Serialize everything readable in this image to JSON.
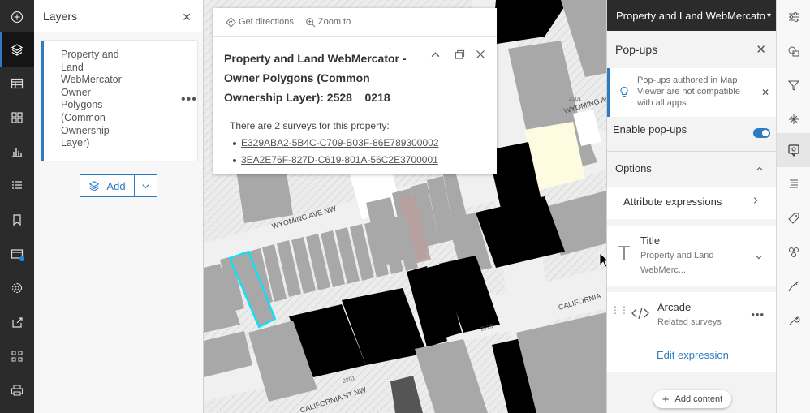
{
  "left_rail": {
    "icons": [
      "add-circle-icon",
      "layers-icon",
      "table-icon",
      "basemap-icon",
      "charts-icon",
      "legend-icon",
      "bookmark-icon",
      "media-icon",
      "settings-icon",
      "share-icon",
      "apps-icon",
      "print-icon"
    ]
  },
  "layers_panel": {
    "title": "Layers",
    "layer_name": "Property and Land WebMercator - Owner Polygons (Common Ownership Layer)",
    "add_label": "Add"
  },
  "map": {
    "streets": [
      "WYOMING AVE NW",
      "WYOMING AVE",
      "CALIFORNIA",
      "CALIFORNIA ST NW"
    ],
    "numbers": [
      "2101",
      "2125",
      "2201"
    ]
  },
  "popup": {
    "toolbar": {
      "directions": "Get directions",
      "zoom": "Zoom to"
    },
    "title": "Property and Land WebMercator - Owner Polygons (Common Ownership Layer): 2528    0218",
    "intro": "There are 2 surveys for this property:",
    "links": [
      "E329ABA2-5B4C-C709-B03F-86E789300002",
      "3EA2E76F-827D-C619-801A-56C2E3700001"
    ]
  },
  "config_panel": {
    "header": "Property and Land WebMercato",
    "section_title": "Pop-ups",
    "notice": "Pop-ups authored in Map Viewer are not compatible with all apps.",
    "enable_label": "Enable pop-ups",
    "enable_on": true,
    "options_label": "Options",
    "attribute_expressions": "Attribute expressions",
    "title_card": {
      "label": "Title",
      "value": "Property and Land WebMerc..."
    },
    "arcade_card": {
      "label": "Arcade",
      "value": "Related surveys",
      "edit": "Edit expression"
    },
    "add_content": "Add content"
  },
  "right_rail": {
    "icons": [
      "properties-icon",
      "styles-icon",
      "filter-icon",
      "effects-icon",
      "popups-icon",
      "fields-icon",
      "labels-icon",
      "clustering-icon",
      "sketch-icon",
      "configure-icon"
    ]
  },
  "colors": {
    "accent": "#2d7bc2",
    "dark_rail": "#2b2b2b",
    "highlight": "#00e5ff"
  }
}
